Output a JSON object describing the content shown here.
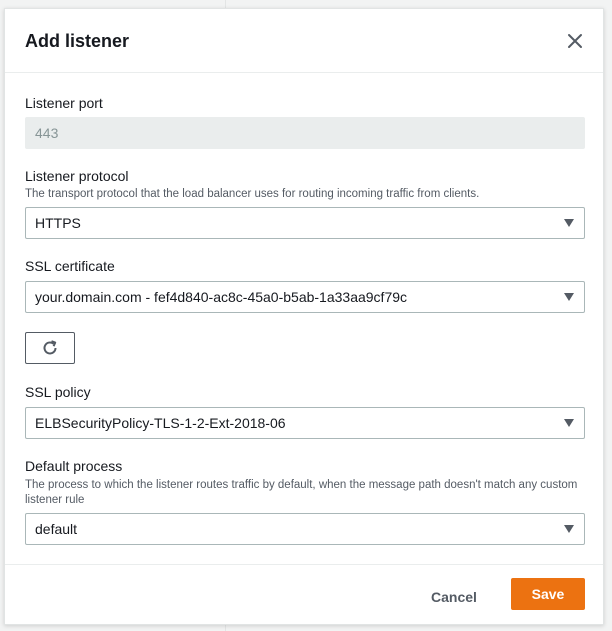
{
  "modal": {
    "title": "Add listener",
    "close_icon": "close-icon"
  },
  "listener_port": {
    "label": "Listener port",
    "value": "443"
  },
  "listener_protocol": {
    "label": "Listener protocol",
    "description": "The transport protocol that the load balancer uses for routing incoming traffic from clients.",
    "selected": "HTTPS"
  },
  "ssl_certificate": {
    "label": "SSL certificate",
    "selected": "your.domain.com - fef4d840-ac8c-45a0-b5ab-1a33aa9cf79c",
    "refresh_icon": "refresh-icon"
  },
  "ssl_policy": {
    "label": "SSL policy",
    "selected": "ELBSecurityPolicy-TLS-1-2-Ext-2018-06"
  },
  "default_process": {
    "label": "Default process",
    "description": "The process to which the listener routes traffic by default, when the message path doesn't match any custom listener rule",
    "selected": "default"
  },
  "footer": {
    "cancel_label": "Cancel",
    "save_label": "Save"
  },
  "colors": {
    "primary_button": "#ec7211",
    "text": "#16191f",
    "muted_text": "#545b64"
  }
}
